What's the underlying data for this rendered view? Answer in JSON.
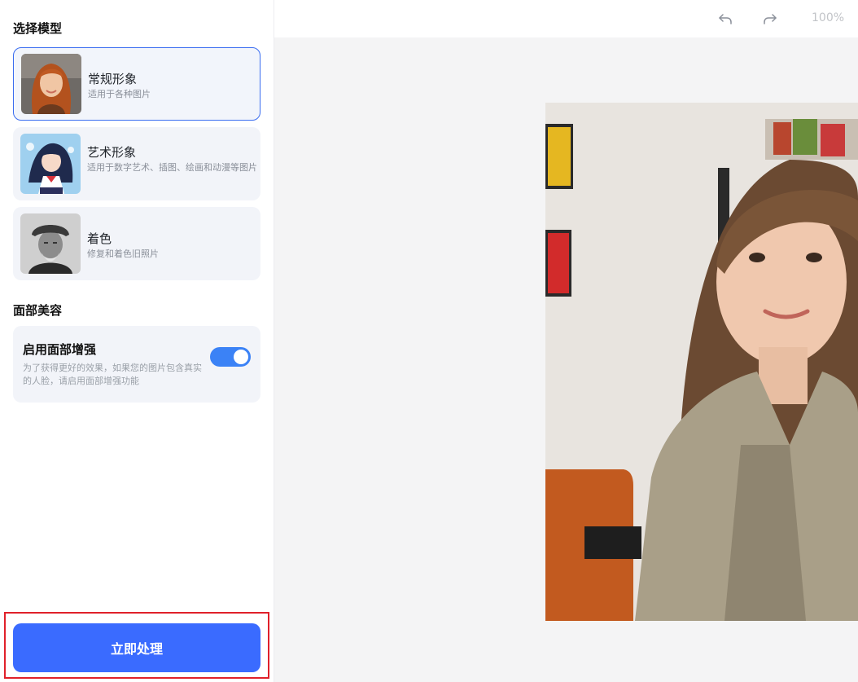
{
  "model_section": {
    "title": "选择模型",
    "options": [
      {
        "title": "常规形象",
        "desc": "适用于各种图片",
        "thumb_icon": "portrait-redhead-woman-icon",
        "selected": true
      },
      {
        "title": "艺术形象",
        "desc": "适用于数字艺术、插图、绘画和动漫等图片",
        "thumb_icon": "anime-girl-icon",
        "selected": false
      },
      {
        "title": "着色",
        "desc": "修复和着色旧照片",
        "thumb_icon": "old-man-bw-photo-icon",
        "selected": false
      }
    ]
  },
  "face_section": {
    "title": "面部美容",
    "enhance_title": "启用面部增强",
    "enhance_desc": "为了获得更好的效果，如果您的图片包含真实的人脸，请启用面部增强功能",
    "enabled": true
  },
  "process_button": "立即处理",
  "toolbar": {
    "undo_icon": "undo-icon",
    "redo_icon": "redo-icon",
    "zoom": "100%"
  },
  "colors": {
    "accent": "#3a6bff",
    "toggle_on": "#3b82f6",
    "selected_border": "#3a6df0",
    "highlight": "#e0202a"
  }
}
